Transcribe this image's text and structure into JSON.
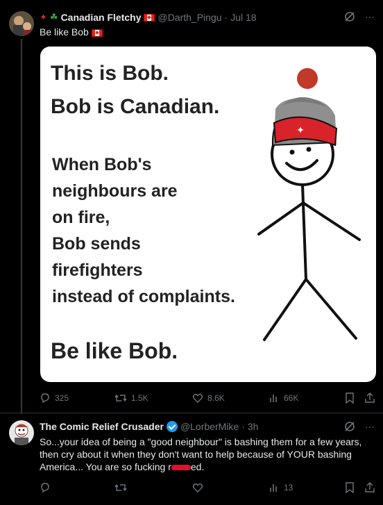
{
  "tweet1": {
    "display_name": "Canadian Fletchy",
    "handle": "@Darth_Pingu",
    "timestamp": "Jul 18",
    "text": "Be like Bob",
    "meme": {
      "line1": "This is Bob.",
      "line2": "Bob is Canadian.",
      "body": [
        "When Bob's",
        "neighbours are",
        "on fire,",
        "Bob sends",
        "firefighters",
        "instead of complaints."
      ],
      "closing": "Be like Bob."
    },
    "stats": {
      "replies": "325",
      "reposts": "1.5K",
      "likes": "8.6K",
      "views": "66K"
    }
  },
  "tweet2": {
    "display_name": "The Comic Relief Crusader",
    "handle": "@LorberMike",
    "timestamp": "3h",
    "text_line1": "So...your idea of being a \"good neighbour\" is bashing them for a few years,",
    "text_line2": "then cry about it when they don't want to help because of YOUR bashing",
    "text_line3_a": "America...  You are so fucking r",
    "text_line3_b": "ed.",
    "stats": {
      "views": "13"
    }
  },
  "colors": {
    "background": "#000000",
    "secondary_text": "#71767b",
    "verified": "#1d9bf0",
    "canada_red": "#d52b1e"
  },
  "icons": [
    "maple-leaf-icon",
    "shamrock-icon",
    "canada-flag-icon",
    "grok-icon",
    "more-icon",
    "reply-icon",
    "repost-icon",
    "like-icon",
    "views-icon",
    "bookmark-icon",
    "share-icon",
    "verified-badge-icon"
  ]
}
